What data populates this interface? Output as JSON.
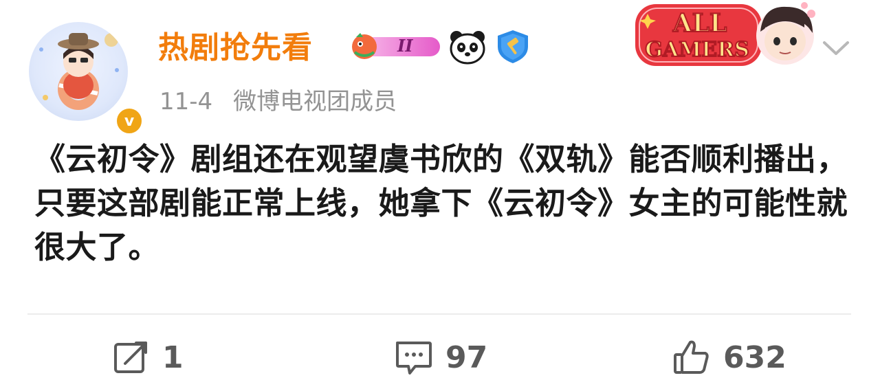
{
  "post": {
    "username": "热剧抢先看",
    "rank_badge": "II",
    "date": "11-4",
    "source": "微博电视团成员",
    "verified_mark": "v",
    "sticker_text": {
      "line1": "ALL",
      "line2": "GAMERS"
    },
    "content": "《云初令》剧组还在观望虞书欣的《双轨》能否顺利播出，只要这部剧能正常上线，她拿下《云初令》女主的可能性就很大了。"
  },
  "actions": {
    "repost_count": "1",
    "comment_count": "97",
    "like_count": "632"
  },
  "colors": {
    "username": "#f27d0c",
    "meta": "#939393",
    "body": "#1a1a1a",
    "action": "#5a5a5a",
    "verified": "#f0a516"
  },
  "icons": {
    "repost": "repost-icon",
    "comment": "comment-icon",
    "like": "like-icon",
    "more": "chevron-down-icon"
  }
}
